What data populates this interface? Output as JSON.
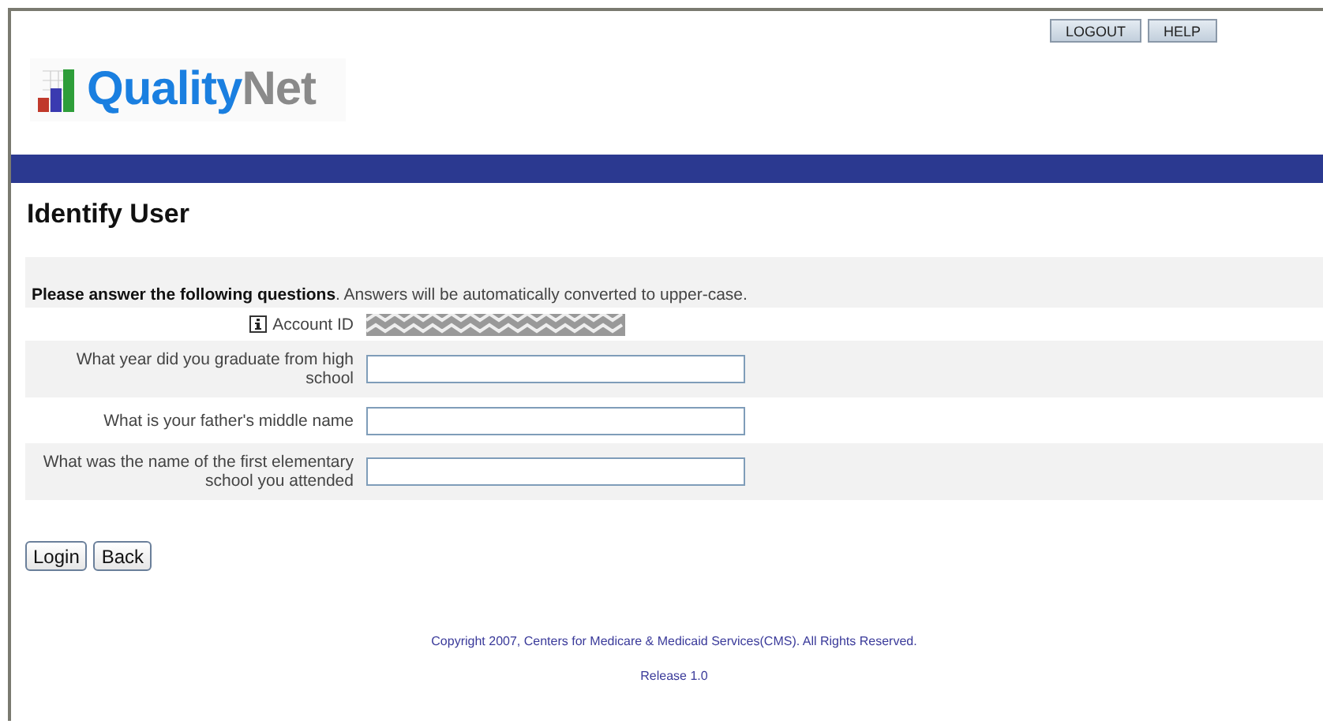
{
  "header_buttons": [
    "LOGOUT",
    "HELP"
  ],
  "logo": {
    "primary": "Quality",
    "secondary": "Net"
  },
  "page_title": "Identify User",
  "form": {
    "instruction": "**Please answer the following questions**. Answers will be automatically converted to upper-case.",
    "account_label": "Account ID",
    "questions": [
      {
        "label": "What year did you graduate from high school"
      },
      {
        "label": "What is your father's middle name"
      },
      {
        "label": "What was the name of the first elementary school you attended"
      }
    ]
  },
  "buttons": [
    "Login",
    "Back"
  ],
  "footer": {
    "copyright": "Copyright 2007, Centers for Medicare & Medicaid Services(CMS). All Rights Reserved.",
    "release": "Release 1.0"
  }
}
